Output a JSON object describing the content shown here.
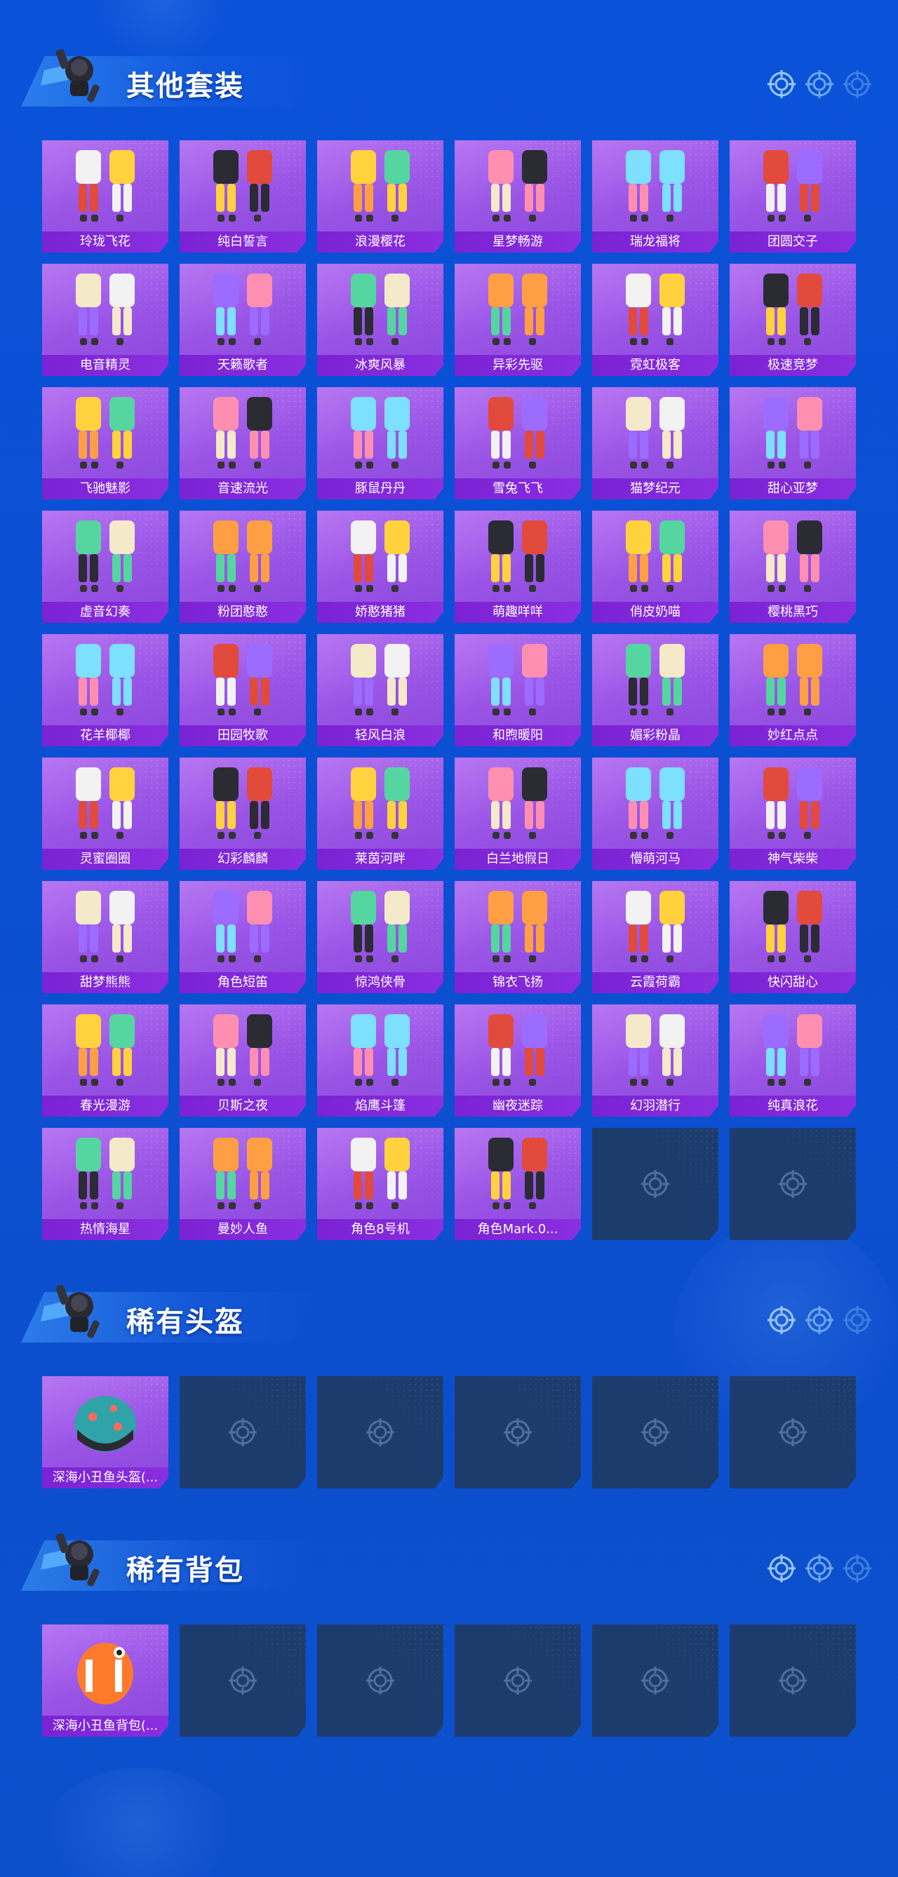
{
  "colors": {
    "background": "#0b4fd3",
    "card": "#9a55e6",
    "card_label": "#7a22d4",
    "empty_card": "#1d3c6e"
  },
  "sections": [
    {
      "title": "其他套装",
      "items": [
        "玲珑飞花",
        "纯白誓言",
        "浪漫樱花",
        "星梦畅游",
        "瑞龙福将",
        "团圆交子",
        "电音精灵",
        "天籁歌者",
        "冰爽风暴",
        "异彩先驱",
        "霓虹极客",
        "极速竞梦",
        "飞驰魅影",
        "音速流光",
        "豚鼠丹丹",
        "雪兔飞飞",
        "猫梦纪元",
        "甜心亚梦",
        "虚音幻奏",
        "粉团憨憨",
        "娇憨猪猪",
        "萌趣咩咩",
        "俏皮奶喵",
        "樱桃黑巧",
        "花羊椰椰",
        "田园牧歌",
        "轻风白浪",
        "和煦暖阳",
        "媚彩粉晶",
        "妙红点点",
        "灵蜜圈圈",
        "幻彩麟麟",
        "莱茵河畔",
        "白兰地假日",
        "懵萌河马",
        "神气柴柴",
        "甜梦熊熊",
        "角色短笛",
        "惊鸿侠骨",
        "锦衣飞扬",
        "云霞荷霸",
        "快闪甜心",
        "春光漫游",
        "贝斯之夜",
        "焰鹰斗篷",
        "幽夜迷踪",
        "幻羽潜行",
        "纯真浪花",
        "热情海星",
        "曼妙人鱼",
        "角色8号机",
        "角色Mark.0..."
      ],
      "empty_slots": 2
    },
    {
      "title": "稀有头盔",
      "items": [
        "深海小丑鱼头盔(..."
      ],
      "empty_slots": 5
    },
    {
      "title": "稀有背包",
      "items": [
        "深海小丑鱼背包(..."
      ],
      "empty_slots": 5
    }
  ]
}
